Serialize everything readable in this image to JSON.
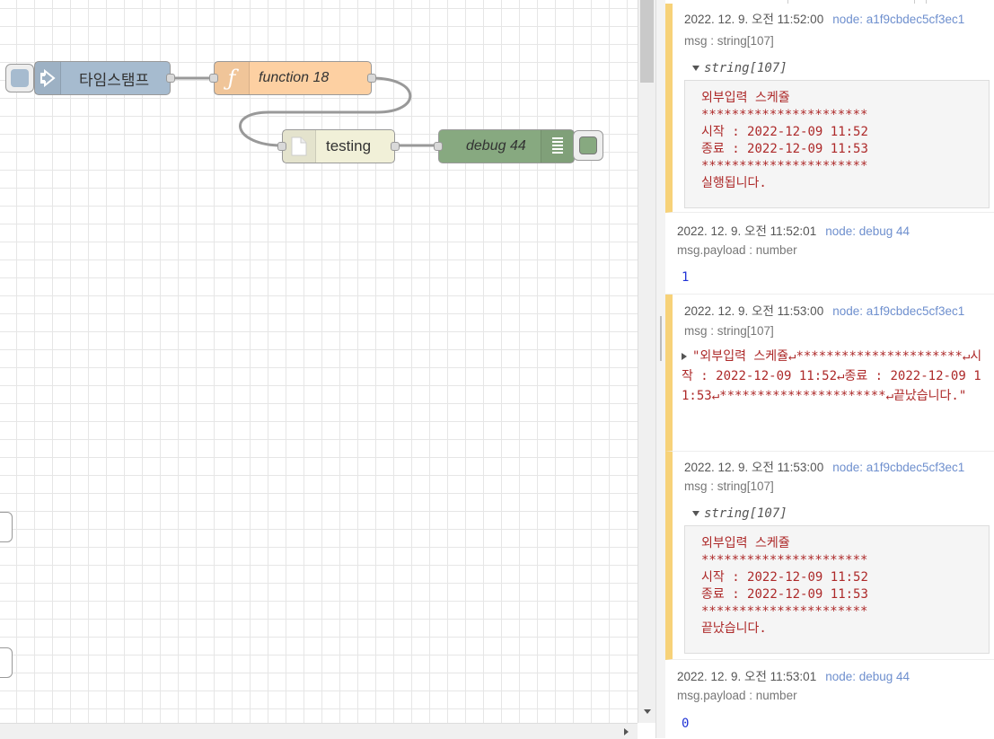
{
  "colors": {
    "inject_node": "#a6bbcf",
    "function_node": "#fdd0a2",
    "file_node": "#f1f0d8",
    "debug_node": "#87a980",
    "warn_stripe": "#f7d279",
    "string_red": "#ad2929",
    "number_blue": "#2033d6",
    "node_link": "#6e8fce"
  },
  "flow": {
    "nodes": {
      "inject": {
        "label": "타임스탬프",
        "icon": "arrow-in-icon"
      },
      "function": {
        "label": "function 18",
        "icon": "function-icon"
      },
      "file": {
        "label": "testing",
        "icon": "file-icon"
      },
      "debug": {
        "label": "debug 44",
        "icon": "list-icon"
      }
    }
  },
  "debug_messages": [
    {
      "date": "2022. 12. 9. 오전 11:52:00",
      "node": "node: a1f9cbdec5cf3ec1",
      "topic": "msg : string[107]",
      "type_label": "string[107]",
      "lines": [
        "외부입력 스케쥴",
        "**********************",
        "시작 : 2022-12-09 11:52",
        "종료 : 2022-12-09 11:53",
        "**********************",
        "실행됩니다."
      ]
    },
    {
      "date": "2022. 12. 9. 오전 11:52:01",
      "node": "node: debug 44",
      "topic": "msg.payload : number",
      "value": "1"
    },
    {
      "date": "2022. 12. 9. 오전 11:53:00",
      "node": "node: a1f9cbdec5cf3ec1",
      "topic": "msg : string[107]",
      "collapsed_value": "\"외부입력 스케쥴↵**********************↵시작 : 2022-12-09 11:52↵종료 : 2022-12-09 11:53↵**********************↵끝났습니다.\""
    },
    {
      "date": "2022. 12. 9. 오전 11:53:00",
      "node": "node: a1f9cbdec5cf3ec1",
      "topic": "msg : string[107]",
      "type_label": "string[107]",
      "lines": [
        "외부입력 스케쥴",
        "**********************",
        "시작 : 2022-12-09 11:52",
        "종료 : 2022-12-09 11:53",
        "**********************",
        "끝났습니다."
      ]
    },
    {
      "date": "2022. 12. 9. 오전 11:53:01",
      "node": "node: debug 44",
      "topic": "msg.payload : number",
      "value": "0"
    }
  ]
}
